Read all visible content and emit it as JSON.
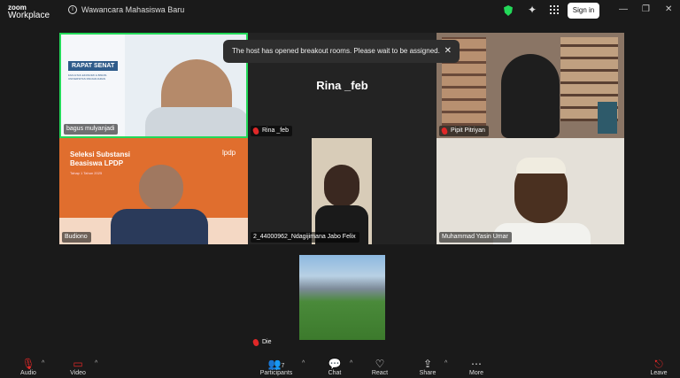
{
  "app": {
    "logo_line1": "zoom",
    "logo_line2": "Workplace",
    "meeting_title": "Wawancara Mahasiswa Baru",
    "signin_label": "Sign in"
  },
  "toast": {
    "text": "The host has opened breakout rooms. Please wait to be assigned."
  },
  "participants": [
    {
      "name": "bagus mulyanjadi",
      "slide_title": "RAPAT SENAT",
      "slide_sub": "FAKULTAS EKONOMI & BISNIS UNIVERSITAS PADJADJARAN"
    },
    {
      "name": "Rina _feb",
      "display_name": "Rina _feb"
    },
    {
      "name": "Pipit Pitriyan"
    },
    {
      "name": "Budiono",
      "slide_title": "Seleksi Substansi Beasiswa LPDP",
      "slide_sub": "Tahap 1 Tahun 2025",
      "slide_brand": "lpdp"
    },
    {
      "name": "2_44000962_Ndagijimana Jabo Felix"
    },
    {
      "name": "Muhammad Yasin Umar"
    },
    {
      "name": "Die"
    }
  ],
  "toolbar": {
    "audio": "Audio",
    "video": "Video",
    "participants": "Participants",
    "participants_count": "7",
    "chat": "Chat",
    "react": "React",
    "share": "Share",
    "more": "More",
    "leave": "Leave"
  }
}
